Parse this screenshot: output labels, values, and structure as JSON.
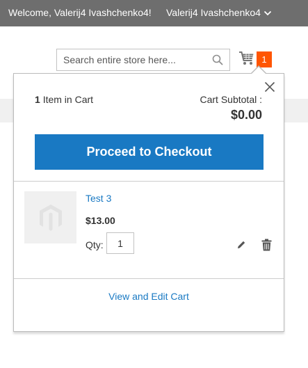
{
  "header": {
    "welcome_text": "Welcome, Valerij4 Ivashchenko4!",
    "account_name": "Valerij4 Ivashchenko4"
  },
  "search": {
    "placeholder": "Search entire store here...",
    "value": ""
  },
  "cart": {
    "badge_count": "1"
  },
  "minicart": {
    "items_count": "1",
    "items_label": "Item in Cart",
    "subtotal_label": "Cart Subtotal :",
    "subtotal_value": "$0.00",
    "checkout_label": "Proceed to Checkout",
    "items": [
      {
        "name": "Test 3",
        "price": "$13.00",
        "qty_label": "Qty:",
        "qty_value": "1"
      }
    ],
    "view_edit_label": "View and Edit Cart"
  },
  "colors": {
    "topbar": "#6e6e6e",
    "accent_blue": "#1979c3",
    "badge_orange": "#ff5501"
  }
}
